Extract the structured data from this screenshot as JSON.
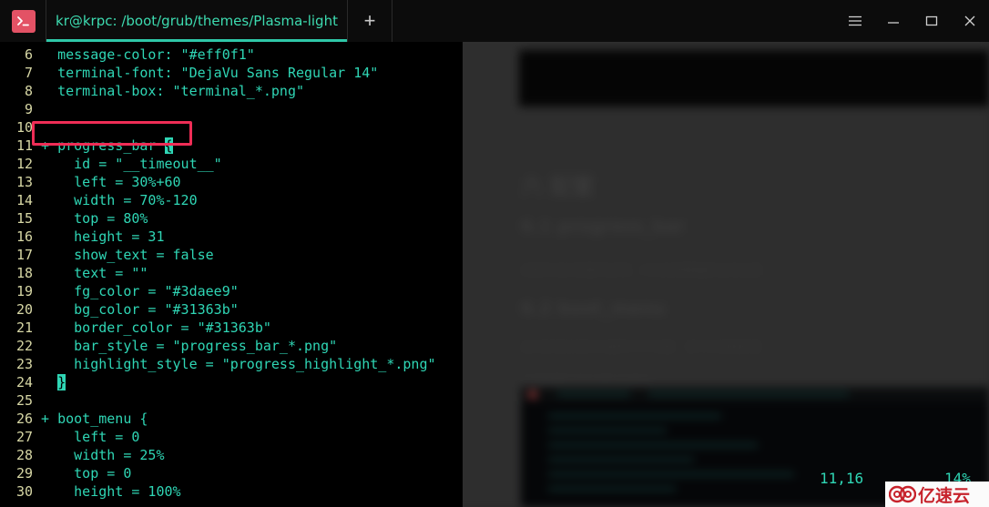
{
  "window": {
    "app_icon": "terminal-icon",
    "tab_title": "kr@krpc: /boot/grub/themes/Plasma-light",
    "new_tab_label": "+",
    "controls": {
      "menu": "hamburger-menu-icon",
      "minimize": "minimize-icon",
      "maximize": "maximize-icon",
      "close": "close-icon"
    }
  },
  "editor": {
    "lines": [
      {
        "num": "6",
        "marker": "",
        "text": "message-color: \"#eff0f1\""
      },
      {
        "num": "7",
        "marker": "",
        "text": "terminal-font: \"DejaVu Sans Regular 14\""
      },
      {
        "num": "8",
        "marker": "",
        "text": "terminal-box: \"terminal_*.png\""
      },
      {
        "num": "9",
        "marker": "",
        "text": ""
      },
      {
        "num": "10",
        "marker": "",
        "text": ""
      },
      {
        "num": "11",
        "marker": "+",
        "text": "progress_bar ",
        "cursor": "{"
      },
      {
        "num": "12",
        "marker": "",
        "text": "  id = \"__timeout__\""
      },
      {
        "num": "13",
        "marker": "",
        "text": "  left = 30%+60"
      },
      {
        "num": "14",
        "marker": "",
        "text": "  width = 70%-120"
      },
      {
        "num": "15",
        "marker": "",
        "text": "  top = 80%"
      },
      {
        "num": "16",
        "marker": "",
        "text": "  height = 31"
      },
      {
        "num": "17",
        "marker": "",
        "text": "  show_text = false"
      },
      {
        "num": "18",
        "marker": "",
        "text": "  text = \"\""
      },
      {
        "num": "19",
        "marker": "",
        "text": "  fg_color = \"#3daee9\""
      },
      {
        "num": "20",
        "marker": "",
        "text": "  bg_color = \"#31363b\""
      },
      {
        "num": "21",
        "marker": "",
        "text": "  border_color = \"#31363b\""
      },
      {
        "num": "22",
        "marker": "",
        "text": "  bar_style = \"progress_bar_*.png\""
      },
      {
        "num": "23",
        "marker": "",
        "text": "  highlight_style = \"progress_highlight_*.png\""
      },
      {
        "num": "24",
        "marker": "",
        "text": "",
        "cursor": "}"
      },
      {
        "num": "25",
        "marker": "",
        "text": ""
      },
      {
        "num": "26",
        "marker": "+",
        "text": "boot_menu {"
      },
      {
        "num": "27",
        "marker": "",
        "text": "  left = 0"
      },
      {
        "num": "28",
        "marker": "",
        "text": "  width = 25%"
      },
      {
        "num": "29",
        "marker": "",
        "text": "  top = 0"
      },
      {
        "num": "30",
        "marker": "",
        "text": "  height = 100%"
      }
    ],
    "annotation": {
      "name": "red-highlight-box",
      "color": "#ef2d56",
      "target_line": "11"
    }
  },
  "status": {
    "cursor_position": "11,16",
    "scroll_percent": "14%"
  },
  "watermark": {
    "text": "亿速云",
    "logo_color": "#c7232c"
  },
  "colors": {
    "terminal_background": "#000000",
    "terminal_text": "#2fd6b5",
    "line_number": "#d7d7a5",
    "tab_accent": "#2fc7a8",
    "titlebar": "#0c0c0c",
    "annotation": "#ef2d56"
  }
}
